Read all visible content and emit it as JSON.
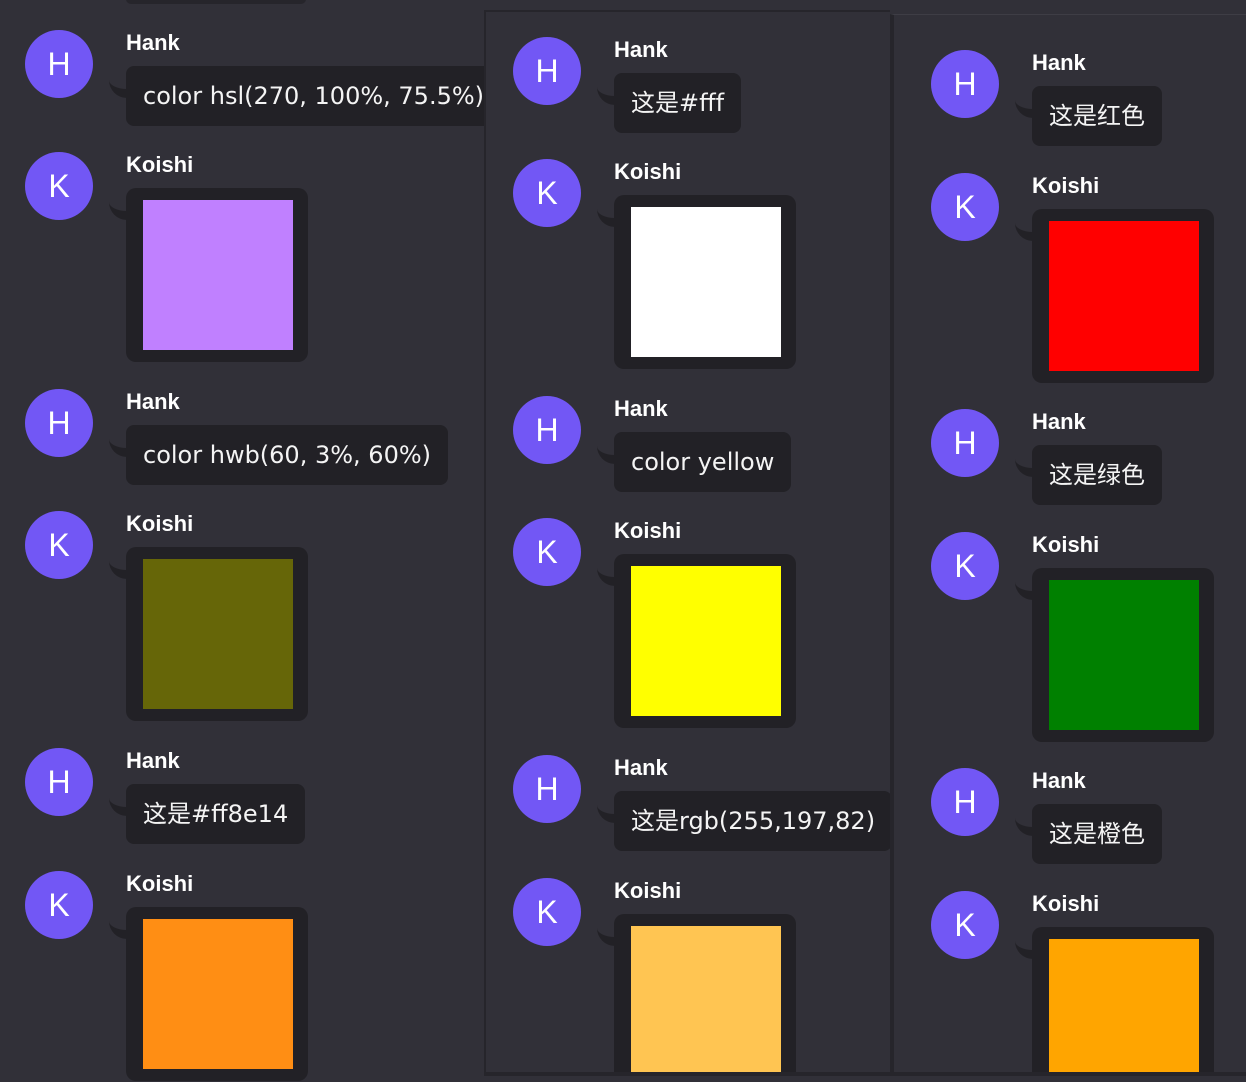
{
  "columns": [
    {
      "messages": [
        {
          "sender": "Hank",
          "avatar_letter": "H",
          "type": "text",
          "text": "color hsl(270, 100%, 75.5%)"
        },
        {
          "sender": "Koishi",
          "avatar_letter": "K",
          "type": "color",
          "color": "#c080ff"
        },
        {
          "sender": "Hank",
          "avatar_letter": "H",
          "type": "text",
          "text": "color hwb(60, 3%, 60%)"
        },
        {
          "sender": "Koishi",
          "avatar_letter": "K",
          "type": "color",
          "color": "#666608"
        },
        {
          "sender": "Hank",
          "avatar_letter": "H",
          "type": "text",
          "text": "这是#ff8e14"
        },
        {
          "sender": "Koishi",
          "avatar_letter": "K",
          "type": "color",
          "color": "#ff8e14"
        }
      ]
    },
    {
      "messages": [
        {
          "sender": "Hank",
          "avatar_letter": "H",
          "type": "text",
          "text": "这是#fff"
        },
        {
          "sender": "Koishi",
          "avatar_letter": "K",
          "type": "color",
          "color": "#ffffff"
        },
        {
          "sender": "Hank",
          "avatar_letter": "H",
          "type": "text",
          "text": "color yellow"
        },
        {
          "sender": "Koishi",
          "avatar_letter": "K",
          "type": "color",
          "color": "#ffff00"
        },
        {
          "sender": "Hank",
          "avatar_letter": "H",
          "type": "text",
          "text": "这是rgb(255,197,82)"
        },
        {
          "sender": "Koishi",
          "avatar_letter": "K",
          "type": "color",
          "color": "#ffc552"
        }
      ]
    },
    {
      "messages": [
        {
          "sender": "Hank",
          "avatar_letter": "H",
          "type": "text",
          "text": "这是红色"
        },
        {
          "sender": "Koishi",
          "avatar_letter": "K",
          "type": "color",
          "color": "#ff0000"
        },
        {
          "sender": "Hank",
          "avatar_letter": "H",
          "type": "text",
          "text": "这是绿色"
        },
        {
          "sender": "Koishi",
          "avatar_letter": "K",
          "type": "color",
          "color": "#008000"
        },
        {
          "sender": "Hank",
          "avatar_letter": "H",
          "type": "text",
          "text": "这是橙色"
        },
        {
          "sender": "Koishi",
          "avatar_letter": "K",
          "type": "color",
          "color": "#ffa500"
        }
      ]
    }
  ]
}
